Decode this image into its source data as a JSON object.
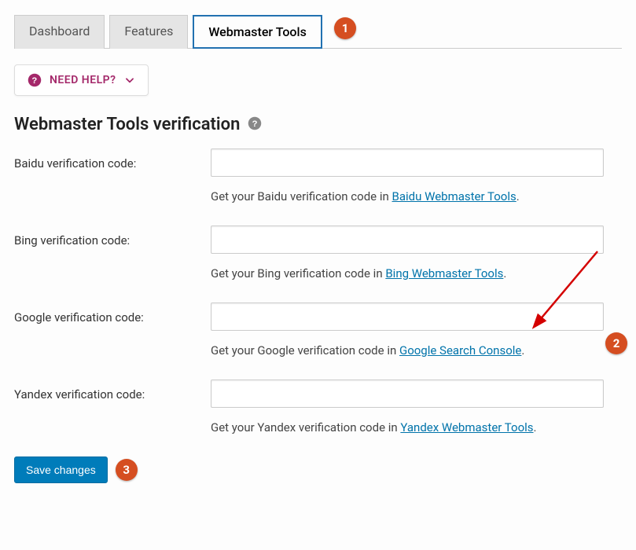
{
  "tabs": {
    "dashboard": "Dashboard",
    "features": "Features",
    "webmaster": "Webmaster Tools"
  },
  "needHelp": "NEED HELP?",
  "heading": "Webmaster Tools verification",
  "fields": {
    "baidu": {
      "label": "Baidu verification code:",
      "value": "",
      "helperPre": "Get your Baidu verification code in ",
      "link": "Baidu Webmaster Tools",
      "helperPost": "."
    },
    "bing": {
      "label": "Bing verification code:",
      "value": "",
      "helperPre": "Get your Bing verification code in ",
      "link": "Bing Webmaster Tools",
      "helperPost": "."
    },
    "google": {
      "label": "Google verification code:",
      "value": "",
      "helperPre": "Get your Google verification code in ",
      "link": "Google Search Console",
      "helperPost": "."
    },
    "yandex": {
      "label": "Yandex verification code:",
      "value": "",
      "helperPre": "Get your Yandex verification code in ",
      "link": "Yandex Webmaster Tools",
      "helperPost": "."
    }
  },
  "save": "Save changes",
  "callouts": {
    "c1": "1",
    "c2": "2",
    "c3": "3"
  }
}
